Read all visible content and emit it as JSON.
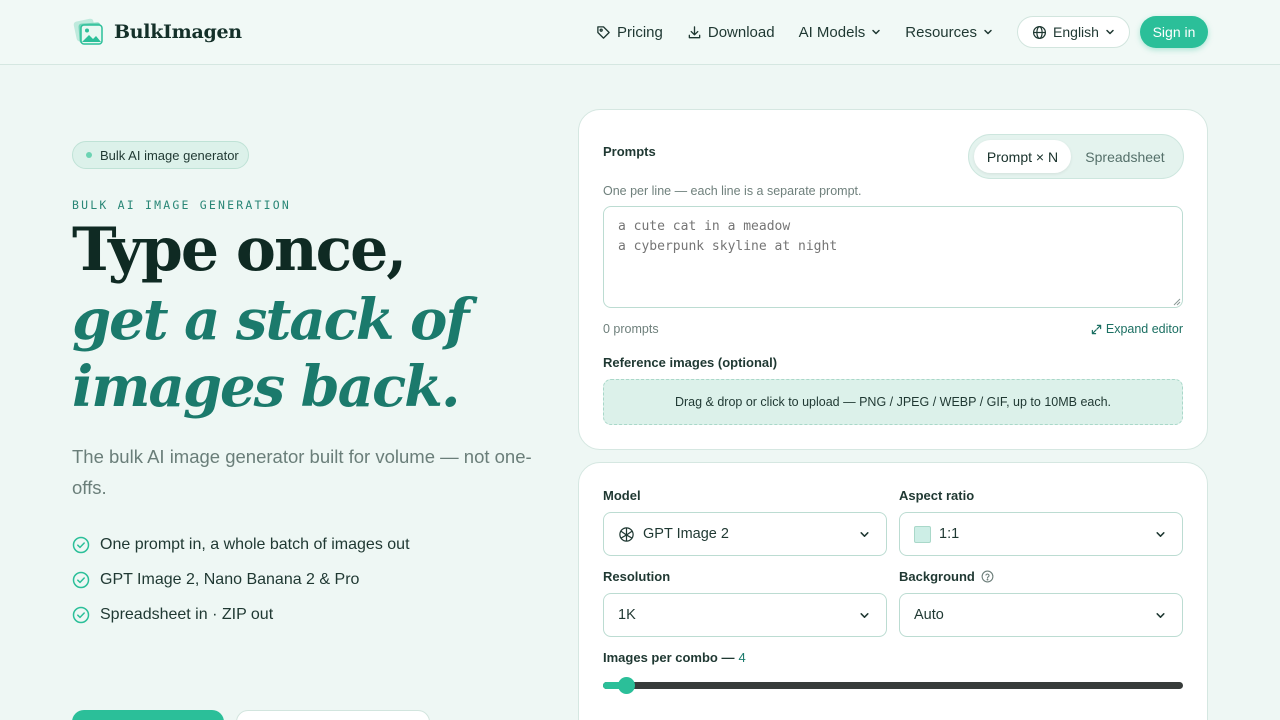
{
  "header": {
    "brand": "BulkImagen",
    "nav": [
      {
        "label": "Pricing",
        "icon": "tag-icon"
      },
      {
        "label": "Download",
        "icon": "download-icon"
      },
      {
        "label": "AI Models",
        "icon": "chevron-down-icon"
      },
      {
        "label": "Resources",
        "icon": "chevron-down-icon"
      }
    ],
    "language": "English",
    "signin": "Sign in"
  },
  "hero": {
    "badge": "Bulk AI image generator",
    "eyebrow": "BULK AI IMAGE GENERATION",
    "title_line1": "Type once,",
    "title_line2": "get a stack of",
    "title_line3": "images back.",
    "subtitle": "The bulk AI image generator built for volume — not one-offs.",
    "features": [
      "One prompt in, a whole batch of images out",
      "GPT Image 2, Nano Banana 2 & Pro",
      "Spreadsheet in · ZIP out"
    ]
  },
  "prompts_card": {
    "label": "Prompts",
    "mode_options": [
      "Prompt × N",
      "Spreadsheet"
    ],
    "mode_selected": "Prompt × N",
    "hint": "One per line — each line is a separate prompt.",
    "placeholder": "a cute cat in a meadow\na cyberpunk skyline at night",
    "count": "0 prompts",
    "expand": "Expand editor",
    "reference_label": "Reference images (optional)",
    "dropzone": "Drag & drop or click to upload — PNG / JPEG / WEBP / GIF, up to 10MB each."
  },
  "settings_card": {
    "model_label": "Model",
    "model_value": "GPT Image 2",
    "aspect_label": "Aspect ratio",
    "aspect_value": "1:1",
    "resolution_label": "Resolution",
    "resolution_value": "1K",
    "background_label": "Background",
    "background_value": "Auto",
    "images_label": "Images per combo —",
    "images_value": "4",
    "images_fraction": 0.04
  },
  "colors": {
    "accent": "#2bbf99",
    "accent_dark": "#1b7a6c",
    "background": "#eef7f4"
  }
}
